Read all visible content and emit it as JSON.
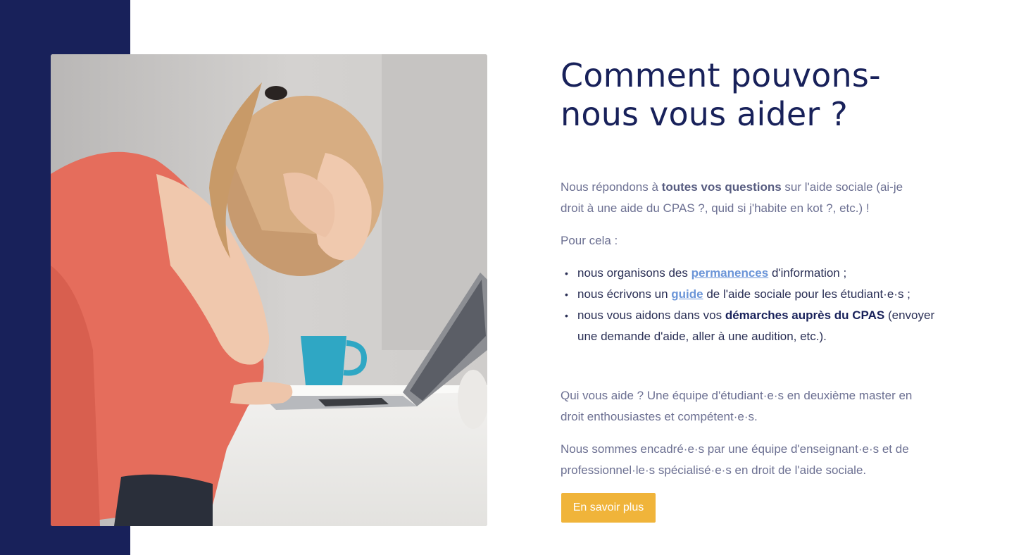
{
  "heading": {
    "title_line1": "Comment pouvons-",
    "title_line2": "nous vous aider ?"
  },
  "intro": {
    "prefix": "Nous répondons à ",
    "emphasis": "toutes vos questions",
    "suffix": " sur l'aide sociale (ai-je droit à une aide du CPAS ?, quid si j'habite en kot ?, etc.) !"
  },
  "pour_cela": "Pour cela :",
  "list": {
    "item1": {
      "prefix": "nous organisons des ",
      "link": "permanences",
      "suffix": " d'information ;"
    },
    "item2": {
      "prefix": "nous écrivons un ",
      "link": "guide",
      "suffix": " de l'aide sociale pour les étudiant·e·s ;"
    },
    "item3": {
      "prefix": "nous vous aidons dans vos ",
      "emphasis": "démarches auprès du CPAS",
      "suffix": " (envoyer une demande d'aide, aller à une audition, etc.)."
    }
  },
  "team": "Qui vous aide ? Une équipe d'étudiant·e·s en deuxième master en droit enthousiastes et compétent·e·s.",
  "supervision": "Nous sommes encadré·e·s par une équipe d'enseignant·e·s et de professionnel·le·s spécialisé·e·s en droit de l'aide sociale.",
  "cta": {
    "label": "En savoir plus"
  },
  "colors": {
    "navy": "#18215a",
    "accent": "#f0b43a",
    "link": "#6b95d8",
    "muted_text": "#6c7092"
  },
  "image": {
    "subject": "stressed-student-photo"
  }
}
